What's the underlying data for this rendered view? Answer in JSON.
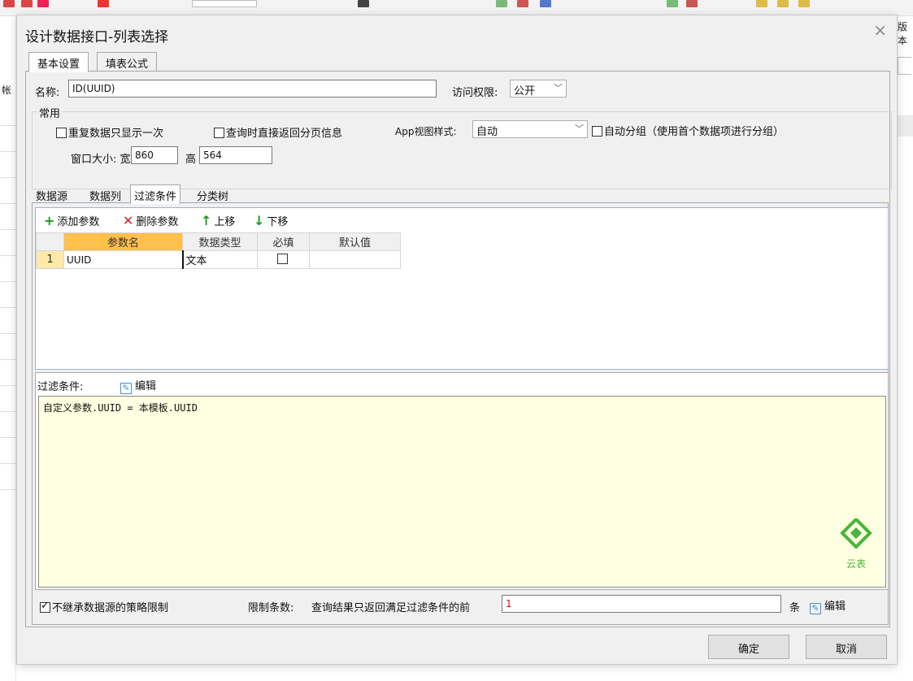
{
  "background": {
    "right_label": "版本",
    "left_label": "帐",
    "toolbar_icon": "app-toolbar-icon"
  },
  "dialog": {
    "title": "设计数据接口-列表选择",
    "close_glyph": "×",
    "tabs": [
      {
        "label": "基本设置",
        "active": true
      },
      {
        "label": "填表公式",
        "active": false
      }
    ],
    "name_label": "名称:",
    "name_value": "ID(UUID)",
    "access_label": "访问权限:",
    "access_value": "公开",
    "common": {
      "title": "常用",
      "repeat_once_label": "重复数据只显示一次",
      "repeat_once_checked": false,
      "return_page_info_label": "查询时直接返回分页信息",
      "return_page_info_checked": false,
      "app_view_label": "App视图样式:",
      "app_view_value": "自动",
      "auto_group_label": "自动分组（使用首个数据项进行分组）",
      "auto_group_checked": false,
      "window_size_label": "窗口大小: 宽",
      "width_value": "860",
      "height_label": "高",
      "height_value": "564"
    },
    "sub_tabs": [
      {
        "label": "数据源",
        "active": false
      },
      {
        "label": "数据列",
        "active": false
      },
      {
        "label": "过滤条件",
        "active": true
      },
      {
        "label": "分类树",
        "active": false
      }
    ],
    "param_toolbar": {
      "add": "添加参数",
      "delete": "删除参数",
      "up": "上移",
      "down": "下移"
    },
    "param_table": {
      "columns": [
        "参数名",
        "数据类型",
        "必填",
        "默认值"
      ],
      "rows": [
        {
          "num": "1",
          "name": "UUID",
          "type": "文本",
          "required": false,
          "default": ""
        }
      ]
    },
    "filter": {
      "label": "过滤条件:",
      "edit": "编辑",
      "expression": "自定义参数.UUID = 本模板.UUID",
      "watermark": "云表"
    },
    "bottom": {
      "no_inherit_label": "不继承数据源的策略限制",
      "no_inherit_checked": true,
      "limit_label": "限制条数:",
      "limit_desc": "查询结果只返回满足过滤条件的前",
      "limit_value": "1",
      "unit": "条",
      "edit": "编辑"
    },
    "ok": "确定",
    "cancel": "取消"
  },
  "colors": {
    "formula_bg": "#ffffe1",
    "header_highlight": "#ffc04c",
    "add_icon": "#1a9a1a",
    "delete_icon": "#e02020",
    "move_icon": "#1a9a1a",
    "watermark": "#49b43a"
  }
}
